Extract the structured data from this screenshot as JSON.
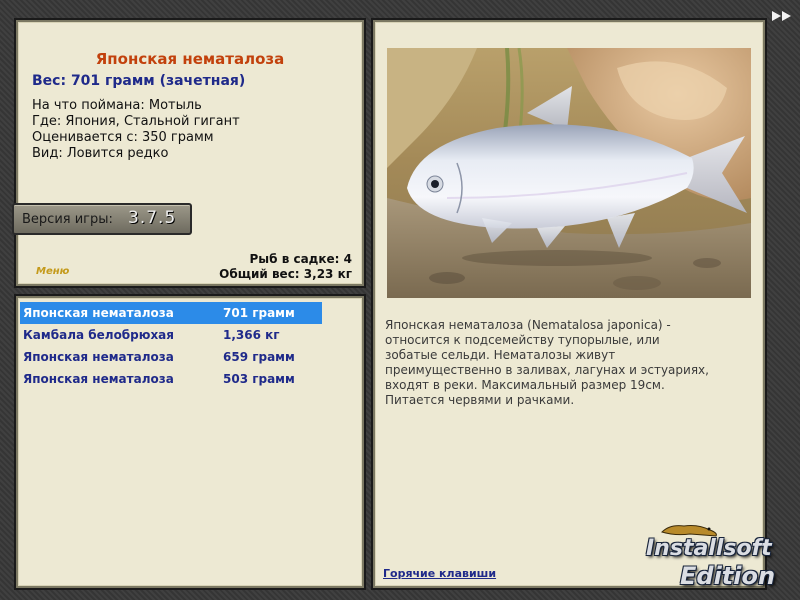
{
  "fish": {
    "name": "Японская нематалоза",
    "weight_text": "Вес: 701 грамм (зачетная)",
    "bait": "На что поймана: Мотыль",
    "location": "Где: Япония, Стальной гигант",
    "rated_from": "Оценивается с: 350 грамм",
    "rarity": "Вид: Ловится редко",
    "description": "Японская нематалоза (Nematalosa japonica) - относится к подсемейству тупорылые, или зобатые сельди. Нематалозы живут преимущественно в заливах, лагунах и эстуариях, входят в реки. Максимальный размер 19см. Питается червями и рачками."
  },
  "version": {
    "label": "Версия игры:",
    "number": "3.7.5"
  },
  "menu_label": "Меню",
  "cage": {
    "count_text": "Рыб в садке: 4",
    "total_weight_text": "Общий вес: 3,23 кг"
  },
  "catch_list": [
    {
      "name": "Японская нематалоза",
      "weight": "701 грамм",
      "selected": true
    },
    {
      "name": "Камбала белобрюхая",
      "weight": "1,366 кг",
      "selected": false
    },
    {
      "name": "Японская нематалоза",
      "weight": "659 грамм",
      "selected": false
    },
    {
      "name": "Японская нематалоза",
      "weight": "503 грамм",
      "selected": false
    }
  ],
  "hotkeys_label": "Горячие клавиши",
  "watermark": {
    "line1": "Installsoft",
    "line2": "Edition"
  },
  "icons": {
    "next": "fast-forward-icon"
  },
  "colors": {
    "panel_bg": "#ede9d3",
    "title_orange": "#c2410c",
    "text_blue": "#1f2a8a",
    "selection_blue": "#2c8be8"
  }
}
